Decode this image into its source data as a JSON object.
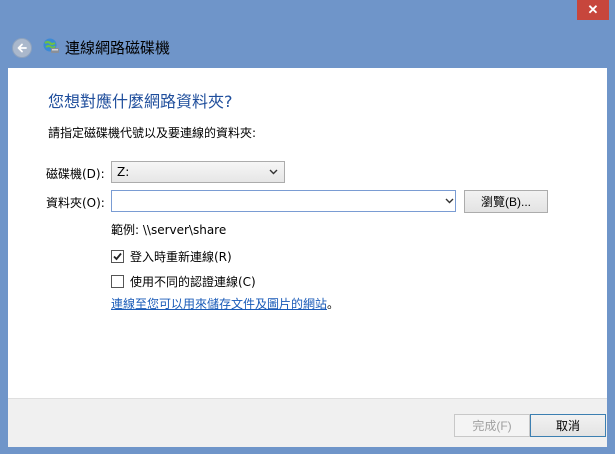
{
  "window": {
    "title": "連線網路磁碟機",
    "close_label": "✕"
  },
  "page": {
    "heading": "您想對應什麼網路資料夾?",
    "instruction": "請指定磁碟機代號以及要連線的資料夾:"
  },
  "drive": {
    "label": "磁碟機(D):",
    "value": "Z:"
  },
  "folder": {
    "label": "資料夾(O):",
    "value": "",
    "browse_label": "瀏覽(B)..."
  },
  "example_text": "範例: \\\\server\\share",
  "options": {
    "reconnect_label": "登入時重新連線(R)",
    "reconnect_checked": true,
    "diff_cred_label": "使用不同的認證連線(C)",
    "diff_cred_checked": false
  },
  "link": {
    "text": "連線至您可以用來儲存文件及圖片的網站",
    "suffix": "。"
  },
  "footer": {
    "finish_label": "完成(F)",
    "cancel_label": "取消"
  },
  "colors": {
    "frame": "#6f95c9",
    "heading": "#1f4e9c",
    "link": "#1a5bb8",
    "close": "#c7463c"
  },
  "icons": {
    "back": "back-arrow-icon",
    "wizard": "network-drive-icon",
    "dropdown": "chevron-down-icon",
    "check": "checkmark-icon"
  }
}
